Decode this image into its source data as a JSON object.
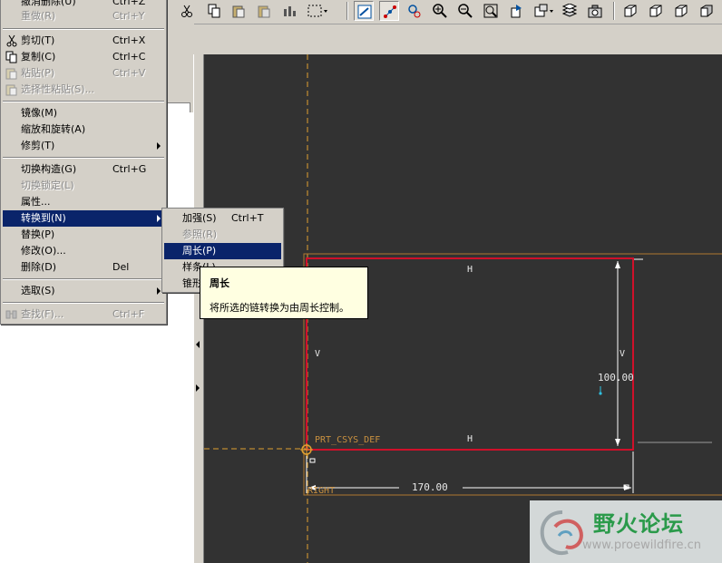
{
  "colors": {
    "menu_bg": "#d4d0c8",
    "selection": "#0a246a",
    "canvas_bg": "#323232",
    "sketch_red": "#d0102a",
    "datum_orange": "#e0a030",
    "tooltip_bg": "#ffffe1",
    "watermark_green": "#2a9a4a"
  },
  "toolbar": {
    "icons": [
      "cut-icon",
      "copy-icon",
      "paste-icon",
      "paste-special-icon",
      "regenerate-icon",
      "select-box-icon",
      "dropdown-icon",
      "sketch-display-icon",
      "vertex-icon",
      "constraint-icon",
      "zoom-in-icon",
      "zoom-out-icon",
      "zoom-fit-icon",
      "repaint-icon",
      "orient-icon",
      "layers-icon",
      "camera-icon",
      "view-iso-icon",
      "view-front-icon",
      "view-top-icon",
      "view-shaded-icon"
    ]
  },
  "edit_menu": {
    "items": [
      {
        "label": "撤消删除(U)",
        "shortcut": "Ctrl+Z",
        "disabled": false
      },
      {
        "label": "重做(R)",
        "shortcut": "Ctrl+Y",
        "disabled": true
      },
      {
        "label": "剪切(T)",
        "shortcut": "Ctrl+X",
        "disabled": false
      },
      {
        "label": "复制(C)",
        "shortcut": "Ctrl+C",
        "disabled": false
      },
      {
        "label": "粘贴(P)",
        "shortcut": "Ctrl+V",
        "disabled": true
      },
      {
        "label": "选择性粘贴(S)...",
        "shortcut": "",
        "disabled": true
      },
      {
        "label": "镜像(M)",
        "shortcut": "",
        "disabled": false
      },
      {
        "label": "缩放和旋转(A)",
        "shortcut": "",
        "disabled": false
      },
      {
        "label": "修剪(T)",
        "shortcut": "",
        "disabled": false,
        "submenu": true
      },
      {
        "label": "切换构造(G)",
        "shortcut": "Ctrl+G",
        "disabled": false
      },
      {
        "label": "切换锁定(L)",
        "shortcut": "",
        "disabled": true
      },
      {
        "label": "属性...",
        "shortcut": "",
        "disabled": false
      },
      {
        "label": "转换到(N)",
        "shortcut": "",
        "disabled": false,
        "submenu": true,
        "selected": true
      },
      {
        "label": "替换(P)",
        "shortcut": "",
        "disabled": false
      },
      {
        "label": "修改(O)...",
        "shortcut": "",
        "disabled": false
      },
      {
        "label": "删除(D)",
        "shortcut": "Del",
        "disabled": false
      },
      {
        "label": "选取(S)",
        "shortcut": "",
        "disabled": false,
        "submenu": true
      },
      {
        "label": "查找(F)...",
        "shortcut": "Ctrl+F",
        "disabled": true
      }
    ]
  },
  "convert_submenu": {
    "items": [
      {
        "label": "加强(S)",
        "shortcut": "Ctrl+T",
        "disabled": false
      },
      {
        "label": "参照(R)",
        "shortcut": "",
        "disabled": true
      },
      {
        "label": "周长(P)",
        "shortcut": "",
        "disabled": false,
        "selected": true
      },
      {
        "label": "样条(L)",
        "shortcut": "",
        "disabled": false
      },
      {
        "label": "锥形",
        "shortcut": "",
        "disabled": false
      }
    ]
  },
  "tooltip": {
    "title": "周长",
    "description": "将所选的链转换为由周长控制。"
  },
  "sketch": {
    "h_label_top": "H",
    "h_label_bottom": "H",
    "v_label_left": "V",
    "v_label_right": "V",
    "dim_vertical": "100.00",
    "dim_horizontal": "170.00",
    "csys_label": "PRT_CSYS_DEF",
    "datum_label": "RIGHT"
  },
  "watermark": {
    "title": "野火论坛",
    "url": "www.proewildfire.cn"
  }
}
